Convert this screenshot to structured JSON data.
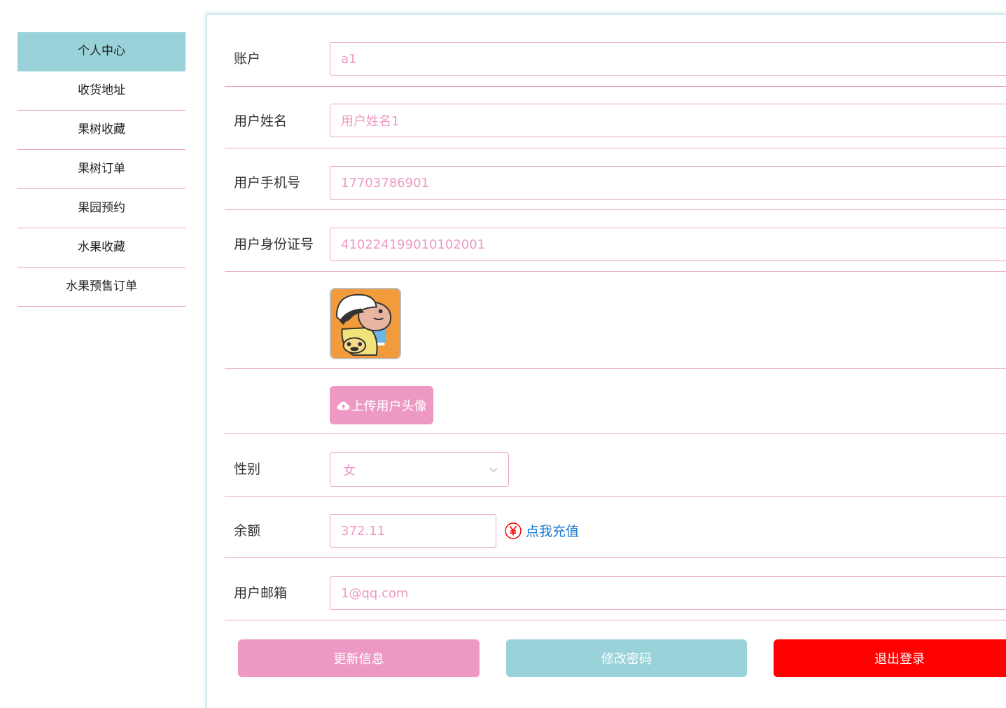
{
  "sidebar": {
    "items": [
      {
        "label": "个人中心"
      },
      {
        "label": "收货地址"
      },
      {
        "label": "果树收藏"
      },
      {
        "label": "果树订单"
      },
      {
        "label": "果园预约"
      },
      {
        "label": "水果收藏"
      },
      {
        "label": "水果预售订单"
      }
    ],
    "active_index": 0
  },
  "form": {
    "account": {
      "label": "账户",
      "value": "a1"
    },
    "name": {
      "label": "用户姓名",
      "value": "用户姓名1"
    },
    "phone": {
      "label": "用户手机号",
      "value": "17703786901"
    },
    "id_card": {
      "label": "用户身份证号",
      "value": "410224199010102001"
    },
    "upload_label": "上传用户头像",
    "gender": {
      "label": "性别",
      "value": "女"
    },
    "balance": {
      "label": "余额",
      "value": "372.11",
      "recharge_label": "点我充值"
    },
    "email": {
      "label": "用户邮箱",
      "value": "1@qq.com"
    }
  },
  "actions": {
    "update": "更新信息",
    "change_password": "修改密码",
    "logout": "退出登录"
  },
  "colors": {
    "pink": "#ee99c4",
    "teal": "#99d3d9",
    "red": "#ff0000",
    "link_blue": "#1677d2"
  }
}
